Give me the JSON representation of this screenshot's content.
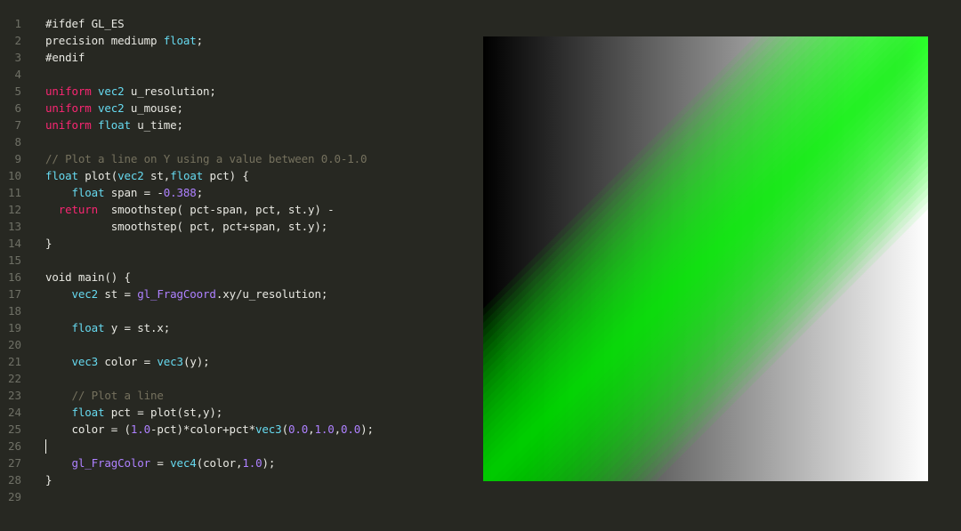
{
  "editor": {
    "lines": [
      {
        "number": "1",
        "segments": [
          {
            "text": "#ifdef GL_ES"
          }
        ]
      },
      {
        "number": "2",
        "segments": [
          {
            "text": "precision mediump "
          },
          {
            "text": "float",
            "style": "ty"
          },
          {
            "text": ";"
          }
        ]
      },
      {
        "number": "3",
        "segments": [
          {
            "text": "#endif"
          }
        ]
      },
      {
        "number": "4",
        "segments": []
      },
      {
        "number": "5",
        "segments": [
          {
            "text": "uniform",
            "style": "kw"
          },
          {
            "text": " "
          },
          {
            "text": "vec2",
            "style": "ty"
          },
          {
            "text": " u_resolution;"
          }
        ]
      },
      {
        "number": "6",
        "segments": [
          {
            "text": "uniform",
            "style": "kw"
          },
          {
            "text": " "
          },
          {
            "text": "vec2",
            "style": "ty"
          },
          {
            "text": " u_mouse;"
          }
        ]
      },
      {
        "number": "7",
        "segments": [
          {
            "text": "uniform",
            "style": "kw"
          },
          {
            "text": " "
          },
          {
            "text": "float",
            "style": "ty"
          },
          {
            "text": " u_time;"
          }
        ]
      },
      {
        "number": "8",
        "segments": []
      },
      {
        "number": "9",
        "segments": [
          {
            "text": "// Plot a line on Y using a value between 0.0-1.0",
            "style": "com"
          }
        ]
      },
      {
        "number": "10",
        "segments": [
          {
            "text": "float",
            "style": "ty"
          },
          {
            "text": " plot("
          },
          {
            "text": "vec2",
            "style": "ty"
          },
          {
            "text": " st,"
          },
          {
            "text": "float",
            "style": "ty"
          },
          {
            "text": " pct) {"
          }
        ]
      },
      {
        "number": "11",
        "segments": [
          {
            "text": "    "
          },
          {
            "text": "float",
            "style": "ty"
          },
          {
            "text": " span = -"
          },
          {
            "text": "0.388",
            "style": "num"
          },
          {
            "text": ";"
          }
        ]
      },
      {
        "number": "12",
        "segments": [
          {
            "text": "  "
          },
          {
            "text": "return",
            "style": "kw"
          },
          {
            "text": "  smoothstep( pct-span, pct, st.y) -"
          }
        ]
      },
      {
        "number": "13",
        "segments": [
          {
            "text": "          smoothstep( pct, pct+span, st.y);"
          }
        ]
      },
      {
        "number": "14",
        "segments": [
          {
            "text": "}"
          }
        ]
      },
      {
        "number": "15",
        "segments": []
      },
      {
        "number": "16",
        "segments": [
          {
            "text": "void main() {"
          }
        ]
      },
      {
        "number": "17",
        "segments": [
          {
            "text": "    "
          },
          {
            "text": "vec2",
            "style": "ty"
          },
          {
            "text": " st = "
          },
          {
            "text": "gl_FragCoord",
            "style": "bi"
          },
          {
            "text": ".xy/u_resolution;"
          }
        ]
      },
      {
        "number": "18",
        "segments": []
      },
      {
        "number": "19",
        "segments": [
          {
            "text": "    "
          },
          {
            "text": "float",
            "style": "ty"
          },
          {
            "text": " y = st.x;"
          }
        ]
      },
      {
        "number": "20",
        "segments": []
      },
      {
        "number": "21",
        "segments": [
          {
            "text": "    "
          },
          {
            "text": "vec3",
            "style": "ty"
          },
          {
            "text": " color = "
          },
          {
            "text": "vec3",
            "style": "ty"
          },
          {
            "text": "(y);"
          }
        ]
      },
      {
        "number": "22",
        "segments": []
      },
      {
        "number": "23",
        "segments": [
          {
            "text": "    "
          },
          {
            "text": "// Plot a line",
            "style": "com"
          }
        ]
      },
      {
        "number": "24",
        "segments": [
          {
            "text": "    "
          },
          {
            "text": "float",
            "style": "ty"
          },
          {
            "text": " pct = plot(st,y);"
          }
        ]
      },
      {
        "number": "25",
        "segments": [
          {
            "text": "    color = ("
          },
          {
            "text": "1.0",
            "style": "num"
          },
          {
            "text": "-pct)*color+pct*"
          },
          {
            "text": "vec3",
            "style": "ty"
          },
          {
            "text": "("
          },
          {
            "text": "0.0",
            "style": "num"
          },
          {
            "text": ","
          },
          {
            "text": "1.0",
            "style": "num"
          },
          {
            "text": ","
          },
          {
            "text": "0.0",
            "style": "num"
          },
          {
            "text": ");"
          }
        ]
      },
      {
        "number": "26",
        "segments": [],
        "cursor": true
      },
      {
        "number": "27",
        "segments": [
          {
            "text": "    "
          },
          {
            "text": "gl_FragColor",
            "style": "bi"
          },
          {
            "text": " = "
          },
          {
            "text": "vec4",
            "style": "ty"
          },
          {
            "text": "(color,"
          },
          {
            "text": "1.0",
            "style": "num"
          },
          {
            "text": ");"
          }
        ]
      },
      {
        "number": "28",
        "segments": [
          {
            "text": "}"
          }
        ]
      },
      {
        "number": "29",
        "segments": []
      }
    ]
  },
  "preview": {
    "shader": {
      "span": -0.388,
      "line_color": "#00ff00",
      "gradient_start_color": "#000000",
      "gradient_end_color": "#ffffff"
    }
  }
}
